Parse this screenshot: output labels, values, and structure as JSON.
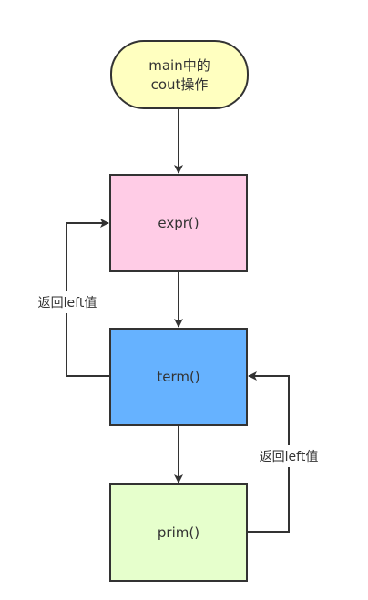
{
  "nodes": {
    "start": {
      "line1": "main中的",
      "line2": "cout操作",
      "fill": "#ffffc0"
    },
    "expr": {
      "label": "expr()",
      "fill": "#ffcce6"
    },
    "term": {
      "label": "term()",
      "fill": "#66b2ff"
    },
    "prim": {
      "label": "prim()",
      "fill": "#e6ffcc"
    }
  },
  "edges": {
    "term_to_expr_label": "返回left值",
    "prim_to_term_label": "返回left值"
  },
  "colors": {
    "stroke": "#333333",
    "text": "#333333"
  }
}
